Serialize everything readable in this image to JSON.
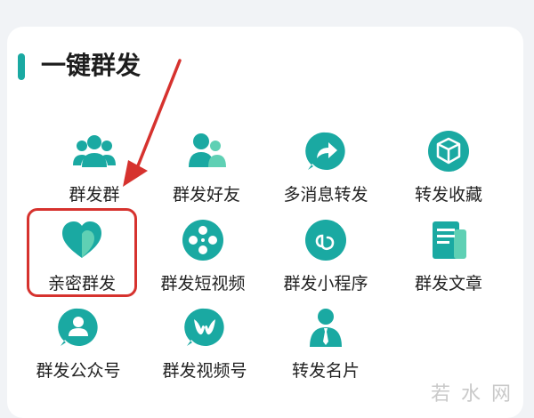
{
  "section": {
    "title": "一键群发"
  },
  "colors": {
    "accent": "#1aa9a2",
    "highlight": "#d6322e"
  },
  "items": [
    {
      "label": "群发群",
      "icon": "group-icon"
    },
    {
      "label": "群发好友",
      "icon": "friends-icon"
    },
    {
      "label": "多消息转发",
      "icon": "forward-chat-icon"
    },
    {
      "label": "转发收藏",
      "icon": "favorites-cube-icon"
    },
    {
      "label": "亲密群发",
      "icon": "heart-icon"
    },
    {
      "label": "群发短视频",
      "icon": "film-reel-icon"
    },
    {
      "label": "群发小程序",
      "icon": "mini-program-icon"
    },
    {
      "label": "群发文章",
      "icon": "article-icon"
    },
    {
      "label": "群发公众号",
      "icon": "official-account-icon"
    },
    {
      "label": "群发视频号",
      "icon": "video-channel-icon"
    },
    {
      "label": "转发名片",
      "icon": "business-card-icon"
    }
  ],
  "watermark": "若水网"
}
